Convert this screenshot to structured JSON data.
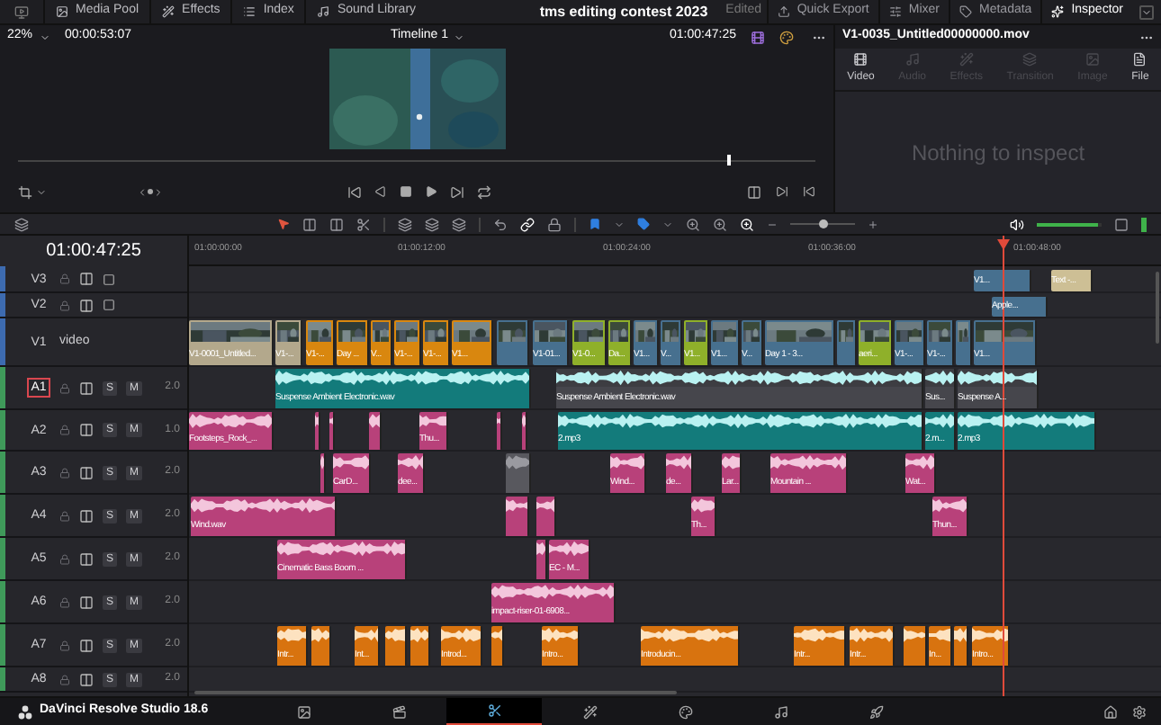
{
  "top_bar": {
    "left_items": [
      {
        "label": "Media Pool"
      },
      {
        "label": "Effects"
      },
      {
        "label": "Index"
      },
      {
        "label": "Sound Library"
      }
    ],
    "project_title": "tms editing contest 2023",
    "status": "Edited",
    "right_items": [
      {
        "label": "Quick Export",
        "selected": false
      },
      {
        "label": "Mixer",
        "selected": false
      },
      {
        "label": "Metadata",
        "selected": false
      },
      {
        "label": "Inspector",
        "selected": true
      }
    ]
  },
  "viewer": {
    "zoom": "22%",
    "duration": "00:00:53:07",
    "timeline_name": "Timeline 1",
    "timecode": "01:00:47:25",
    "scrub": {
      "level": 0.89
    }
  },
  "inspector": {
    "clip_name": "V1-0035_Untitled00000000.mov",
    "tabs": [
      {
        "label": "Video",
        "disabled": false
      },
      {
        "label": "Audio",
        "disabled": true
      },
      {
        "label": "Effects",
        "disabled": true
      },
      {
        "label": "Transition",
        "disabled": true
      },
      {
        "label": "Image",
        "disabled": true
      },
      {
        "label": "File",
        "disabled": false
      }
    ],
    "message": "Nothing to inspect"
  },
  "toolbar": {
    "zoom": {
      "level": 0.5
    },
    "volume": {
      "level": 0.95
    }
  },
  "timeline": {
    "timecode": "01:00:47:25",
    "ruler": [
      "01:00:00:00",
      "01:00:12:00",
      "01:00:24:00",
      "01:00:36:00",
      "01:00:48:00"
    ],
    "tracks": [
      {
        "name": "V3",
        "kind": "video",
        "selected": false,
        "clips": [
          {
            "kind": "video-blue",
            "label": "V1..."
          },
          {
            "kind": "title-tan",
            "label": "Text -..."
          }
        ]
      },
      {
        "name": "V2",
        "kind": "video",
        "selected": false,
        "clips": [
          {
            "kind": "video-blue",
            "label": "Apple..."
          }
        ]
      },
      {
        "name": "V1",
        "kind": "video",
        "selected": false,
        "subtitle": "video",
        "clips": [
          {
            "kind": "video-tan",
            "label": "V1-0001_Untitled..."
          },
          {
            "kind": "video-tan",
            "label": "V1-..."
          },
          {
            "kind": "video-orange",
            "label": "V1-..."
          },
          {
            "kind": "video-orange",
            "label": "Day ..."
          },
          {
            "kind": "video-orange",
            "label": "V..."
          },
          {
            "kind": "video-orange",
            "label": "V1-..."
          },
          {
            "kind": "video-orange",
            "label": "V1-..."
          },
          {
            "kind": "video-orange",
            "label": "V1..."
          },
          {
            "kind": "video-blue"
          },
          {
            "kind": "video-blue",
            "label": "V1-01..."
          },
          {
            "kind": "video-green",
            "label": "V1-0..."
          },
          {
            "kind": "video-green",
            "label": "Da..."
          },
          {
            "kind": "video-blue",
            "label": "V1..."
          },
          {
            "kind": "video-blue",
            "label": "V..."
          },
          {
            "kind": "video-green",
            "label": "V1..."
          },
          {
            "kind": "video-blue",
            "label": "V1..."
          },
          {
            "kind": "video-blue",
            "label": "V..."
          },
          {
            "kind": "video-blue",
            "label": "Day 1 - 3..."
          },
          {
            "kind": "video-blue"
          },
          {
            "kind": "video-green",
            "label": "aeri..."
          },
          {
            "kind": "video-blue",
            "label": "V1-..."
          },
          {
            "kind": "video-blue",
            "label": "V1-..."
          },
          {
            "kind": "video-blue"
          },
          {
            "kind": "video-blue",
            "label": "V1..."
          }
        ]
      },
      {
        "name": "A1",
        "kind": "audio",
        "selected": true,
        "channels": "2.0",
        "solo": "S",
        "mute": "M",
        "clips": [
          {
            "kind": "teal",
            "label": "Suspense Ambient Electronic.wav"
          },
          {
            "kind": "teal-muted",
            "label": "Suspense Ambient Electronic.wav"
          },
          {
            "kind": "teal-muted",
            "label": "Sus..."
          },
          {
            "kind": "teal-muted",
            "label": "Suspense A..."
          }
        ]
      },
      {
        "name": "A2",
        "kind": "audio",
        "selected": false,
        "channels": "1.0",
        "solo": "S",
        "mute": "M",
        "clips": [
          {
            "kind": "pink",
            "label": "Footsteps_Rock_..."
          },
          {
            "kind": "pink"
          },
          {
            "kind": "pink"
          },
          {
            "kind": "pink"
          },
          {
            "kind": "pink",
            "label": "Thu..."
          },
          {
            "kind": "pink"
          },
          {
            "kind": "pink"
          },
          {
            "kind": "teal",
            "label": "2.mp3"
          },
          {
            "kind": "teal",
            "label": "2.m..."
          },
          {
            "kind": "teal",
            "label": "2.mp3"
          }
        ]
      },
      {
        "name": "A3",
        "kind": "audio",
        "selected": false,
        "channels": "2.0",
        "solo": "S",
        "mute": "M",
        "clips": [
          {
            "kind": "pink"
          },
          {
            "kind": "pink",
            "label": "CarD..."
          },
          {
            "kind": "pink",
            "label": "dee..."
          },
          {
            "kind": "grey"
          },
          {
            "kind": "pink",
            "label": "Wind..."
          },
          {
            "kind": "pink",
            "label": "de..."
          },
          {
            "kind": "pink",
            "label": "Lar..."
          },
          {
            "kind": "pink",
            "label": "Mountain ..."
          },
          {
            "kind": "pink",
            "label": "Wat..."
          }
        ]
      },
      {
        "name": "A4",
        "kind": "audio",
        "selected": false,
        "channels": "2.0",
        "solo": "S",
        "mute": "M",
        "clips": [
          {
            "kind": "pink",
            "label": "Wind.wav"
          },
          {
            "kind": "pink"
          },
          {
            "kind": "pink"
          },
          {
            "kind": "pink",
            "label": "Th..."
          },
          {
            "kind": "pink",
            "label": "Thun..."
          }
        ]
      },
      {
        "name": "A5",
        "kind": "audio",
        "selected": false,
        "channels": "2.0",
        "solo": "S",
        "mute": "M",
        "clips": [
          {
            "kind": "pink",
            "label": "Cinematic Bass Boom ..."
          },
          {
            "kind": "pink"
          },
          {
            "kind": "pink",
            "label": "EC - M..."
          }
        ]
      },
      {
        "name": "A6",
        "kind": "audio",
        "selected": false,
        "channels": "2.0",
        "solo": "S",
        "mute": "M",
        "clips": [
          {
            "kind": "pink",
            "label": "impact-riser-01-6908..."
          }
        ]
      },
      {
        "name": "A7",
        "kind": "audio",
        "selected": false,
        "channels": "2.0",
        "solo": "S",
        "mute": "M",
        "clips": [
          {
            "kind": "orange",
            "label": "Intr..."
          },
          {
            "kind": "orange"
          },
          {
            "kind": "orange",
            "label": "Int..."
          },
          {
            "kind": "orange"
          },
          {
            "kind": "orange"
          },
          {
            "kind": "orange",
            "label": "Introd..."
          },
          {
            "kind": "orange"
          },
          {
            "kind": "orange",
            "label": "Intro..."
          },
          {
            "kind": "orange",
            "label": "Introducin..."
          },
          {
            "kind": "orange",
            "label": "Intr..."
          },
          {
            "kind": "orange",
            "label": "Intr..."
          },
          {
            "kind": "orange"
          },
          {
            "kind": "orange",
            "label": "In..."
          },
          {
            "kind": "orange"
          },
          {
            "kind": "orange",
            "label": "Intro..."
          }
        ]
      },
      {
        "name": "A8",
        "kind": "audio",
        "selected": false,
        "channels": "2.0",
        "solo": "S",
        "mute": "M"
      }
    ]
  },
  "bottom_bar": {
    "app_name": "DaVinci Resolve Studio 18.6",
    "pages": [
      {
        "selected": false
      },
      {
        "selected": false
      },
      {
        "selected": true
      },
      {
        "selected": false
      },
      {
        "selected": false
      },
      {
        "selected": false
      },
      {
        "selected": false
      }
    ]
  }
}
